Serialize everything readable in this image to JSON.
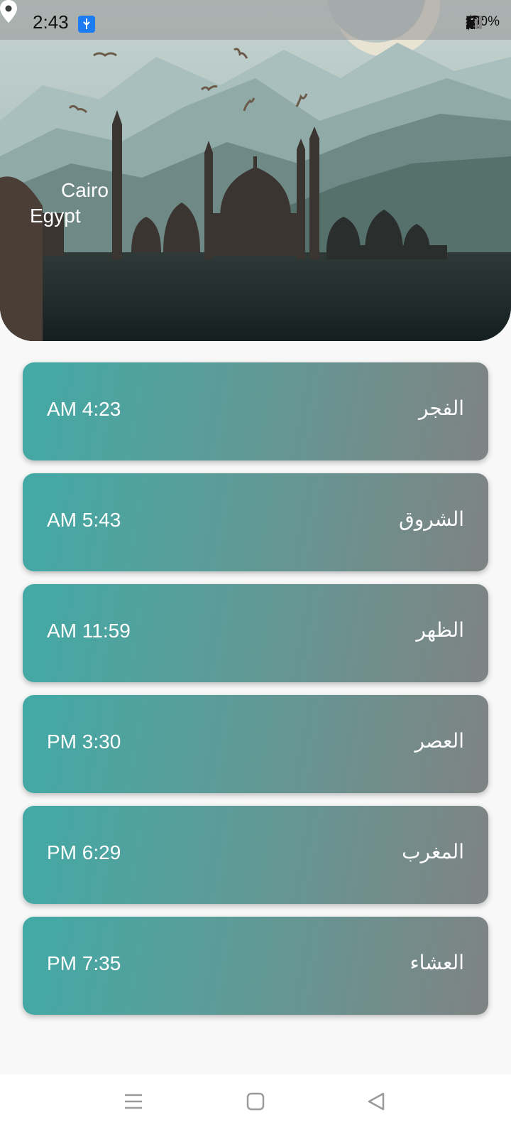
{
  "status_bar": {
    "time": "2:43",
    "battery": "100%",
    "icons": [
      "translate-icon",
      "usb-icon",
      "mute-icon",
      "alarm-icon",
      "wifi-icon",
      "signal-icon",
      "signal-icon",
      "charging-icon"
    ]
  },
  "location": {
    "city": "Cairo",
    "country": "Egypt"
  },
  "prayers": [
    {
      "name": "الفجر",
      "time": "AM 4:23"
    },
    {
      "name": "الشروق",
      "time": "AM 5:43"
    },
    {
      "name": "الظهر",
      "time": "AM 11:59"
    },
    {
      "name": "العصر",
      "time": "PM 3:30"
    },
    {
      "name": "المغرب",
      "time": "PM 6:29"
    },
    {
      "name": "العشاء",
      "time": "PM 7:35"
    }
  ],
  "colors": {
    "card_start": "#42aaa6",
    "card_end": "#7f8383",
    "background": "#f8f8f8"
  },
  "nav_bar": {
    "icons": [
      "menu-icon",
      "home-square-icon",
      "back-triangle-icon"
    ]
  }
}
